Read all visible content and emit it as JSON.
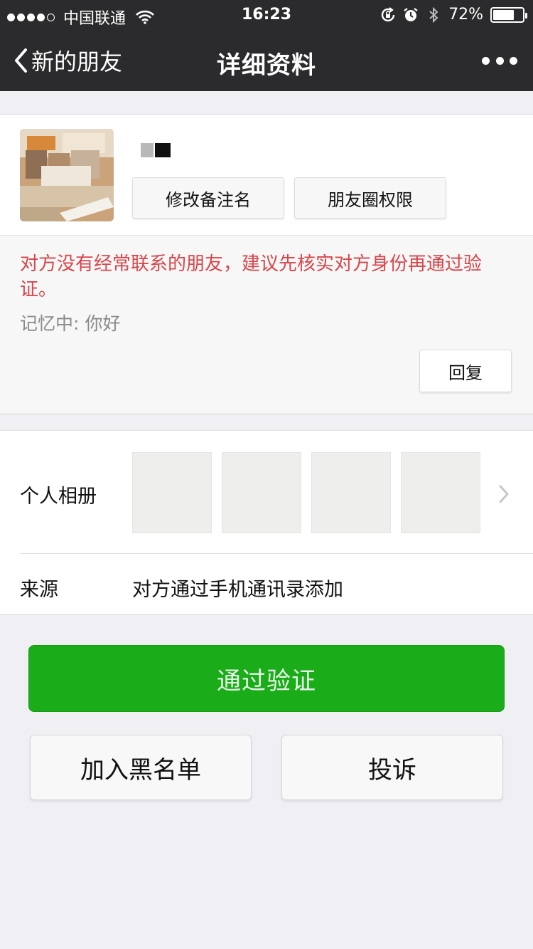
{
  "status_bar": {
    "signal_bars": 4,
    "signal_max": 5,
    "carrier": "中国联通",
    "time": "16:23",
    "battery_text": "72%",
    "battery_level": 0.72
  },
  "nav": {
    "back_label": "新的朋友",
    "title": "详细资料"
  },
  "profile": {
    "remark_button": "修改备注名",
    "moments_button": "朋友圈权限"
  },
  "message": {
    "warning": "对方没有经常联系的朋友，建议先核实对方身份再通过验证。",
    "memo_label": "记忆中:",
    "memo_text": "你好",
    "reply_button": "回复"
  },
  "album": {
    "label": "个人相册"
  },
  "source": {
    "label": "来源",
    "value": "对方通过手机通讯录添加"
  },
  "actions": {
    "verify": "通过验证",
    "blacklist": "加入黑名单",
    "report": "投诉"
  },
  "colors": {
    "primary_green": "#1aad19",
    "warning_red": "#d9454a",
    "nav_background": "#2b2b2d"
  }
}
